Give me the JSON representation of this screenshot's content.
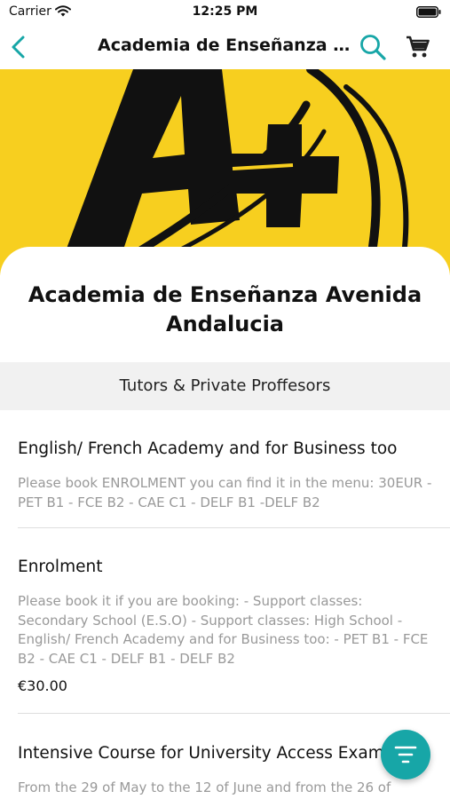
{
  "status_bar": {
    "carrier": "Carrier",
    "time": "12:25 PM"
  },
  "nav": {
    "title": "Academia de Enseñanza Av..."
  },
  "colors": {
    "accent": "#17a6a7",
    "hero_background": "#f7cf1f",
    "category_band": "#f1f1f1"
  },
  "icons": [
    "wifi-icon",
    "battery-icon",
    "back-chevron-icon",
    "search-icon",
    "cart-icon",
    "filter-icon"
  ],
  "shop": {
    "name": "Academia de Enseñanza Avenida Andalucia"
  },
  "category": {
    "label": "Tutors & Private Proffesors"
  },
  "items": [
    {
      "title": "English/ French Academy and for Business too",
      "description": "Please book ENROLMENT you can find it in the menu: 30EUR - PET B1 - FCE B2 - CAE C1 - DELF B1 -DELF B2"
    },
    {
      "title": "Enrolment",
      "description": "Please book it if you are booking: - Support classes: Secondary School (E.S.O) - Support classes: High School - English/ French Academy and for Business too: - PET B1 - FCE B2 - CAE C1 - DELF B1 - DELF B2",
      "price": "€30.00"
    },
    {
      "title": "Intensive Course for University Access Exams",
      "description": "From the 29 of May to the 12 of June and from the 26 of"
    }
  ]
}
